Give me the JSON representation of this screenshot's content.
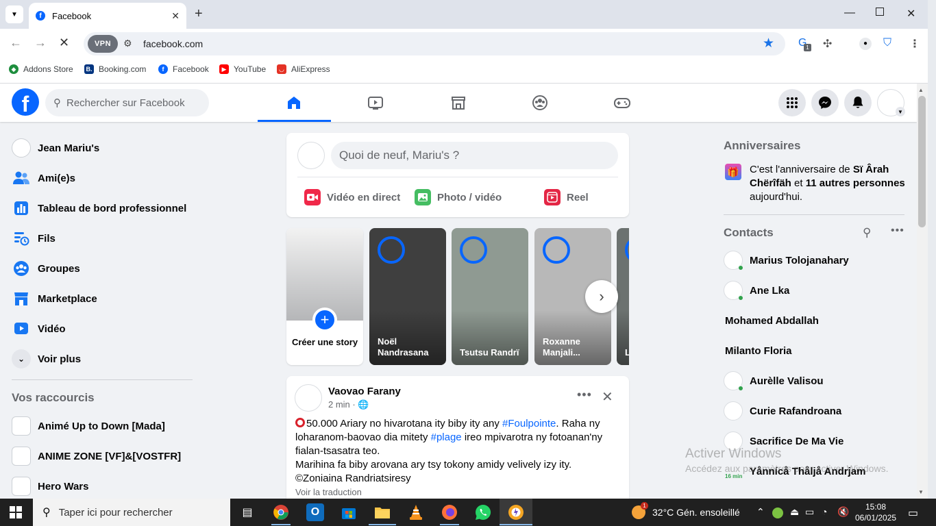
{
  "browser": {
    "tab_title": "Facebook",
    "new_tab_symbol": "+",
    "url": "facebook.com",
    "vpn_label": "VPN",
    "extension_badge": "1",
    "bookmarks": [
      {
        "label": "Addons Store",
        "color": "#1e8e3e"
      },
      {
        "label": "Booking.com",
        "color": "#003580"
      },
      {
        "label": "Facebook",
        "color": "#0866ff"
      },
      {
        "label": "YouTube",
        "color": "#ff0000"
      },
      {
        "label": "AliExpress",
        "color": "#e43225"
      }
    ]
  },
  "fb": {
    "search_placeholder": "Rechercher sur Facebook",
    "nav": [
      "home-icon",
      "video-icon",
      "marketplace-icon",
      "groups-icon",
      "gaming-icon"
    ],
    "accent": "#0866ff"
  },
  "sidebar": {
    "items": [
      {
        "label": "Jean Mariu's",
        "icon": "profile-avatar"
      },
      {
        "label": "Ami(e)s",
        "icon": "friends-icon"
      },
      {
        "label": "Tableau de bord professionnel",
        "icon": "dashboard-icon"
      },
      {
        "label": "Fils",
        "icon": "feeds-icon"
      },
      {
        "label": "Groupes",
        "icon": "groups-icon"
      },
      {
        "label": "Marketplace",
        "icon": "marketplace-icon"
      },
      {
        "label": "Vidéo",
        "icon": "video-icon"
      },
      {
        "label": "Voir plus",
        "icon": "chevron-down-icon"
      }
    ],
    "shortcuts_title": "Vos raccourcis",
    "shortcuts": [
      {
        "label": "Animé Up to Down [Mada]"
      },
      {
        "label": "ANIME ZONE [VF]&[VOSTFR]"
      },
      {
        "label": "Hero Wars"
      }
    ]
  },
  "composer": {
    "placeholder": "Quoi de neuf, Mariu's ?",
    "actions": [
      {
        "label": "Vidéo en direct",
        "color": "#f02849"
      },
      {
        "label": "Photo / vidéo",
        "color": "#45bd62"
      },
      {
        "label": "Reel",
        "color": "#e42645"
      }
    ]
  },
  "stories": {
    "create_label": "Créer une story",
    "items": [
      {
        "name": "Noël Nandrasana",
        "bg": "#3f3f3f"
      },
      {
        "name": "Tsutsu Randrï",
        "bg": "#8f9a92"
      },
      {
        "name": "Roxanne Manjali...",
        "bg": "#b8b8b8"
      },
      {
        "name": "L A",
        "bg": "#6c7270"
      }
    ]
  },
  "post": {
    "author": "Vaovao Farany",
    "meta": "2 min · 🌐",
    "line1_prefix": "50.000 Ariary  no hivarotana ity biby ity any ",
    "hashtag1": "#Foulpointe",
    "line1_suffix": ". Raha ny loharanom-baovao dia mitety ",
    "hashtag2": "#plage",
    "line2_suffix": " ireo mpivarotra ny fotoanan'ny fialan-tsasatra teo.",
    "line3": "Marihina fa biby arovana ary tsy tokony amidy velively izy ity.",
    "line4": "©Zoniaina Randriatsiresy",
    "see_more": "Voir la traduction"
  },
  "right": {
    "birthday_title": "Anniversaires",
    "birthday_prefix": "C'est l'anniversaire de ",
    "birthday_name": "Sï Ârah Chërîfäh",
    "birthday_mid": " et ",
    "birthday_others": "11 autres personnes",
    "birthday_suffix": " aujourd'hui.",
    "contacts_title": "Contacts",
    "contacts": [
      {
        "name": "Marius Tolojanahary",
        "avatar": true,
        "online": true
      },
      {
        "name": "Ane Lka",
        "avatar": true,
        "online": true
      },
      {
        "name": "Mohamed Abdallah",
        "avatar": false,
        "online": false
      },
      {
        "name": "Milanto Floria",
        "avatar": false,
        "online": false
      },
      {
        "name": "Aurèlle Valisou",
        "avatar": true,
        "online": true
      },
      {
        "name": "Curie Rafandroana",
        "avatar": true,
        "online": false
      },
      {
        "name": "Sacrifice De Ma Vie",
        "avatar": true,
        "online": false
      },
      {
        "name": "Yånnícå Thåljå Andrjam",
        "avatar": false,
        "online": false
      }
    ],
    "recent_label": "16 min"
  },
  "watermark": {
    "title": "Activer Windows",
    "subtitle": "Accédez aux paramètres pour activer Windows."
  },
  "taskbar": {
    "search_placeholder": "Taper ici pour rechercher",
    "weather": "32°C  Gén. ensoleillé",
    "weather_badge": "1",
    "time": "15:08",
    "date": "06/01/2025"
  }
}
